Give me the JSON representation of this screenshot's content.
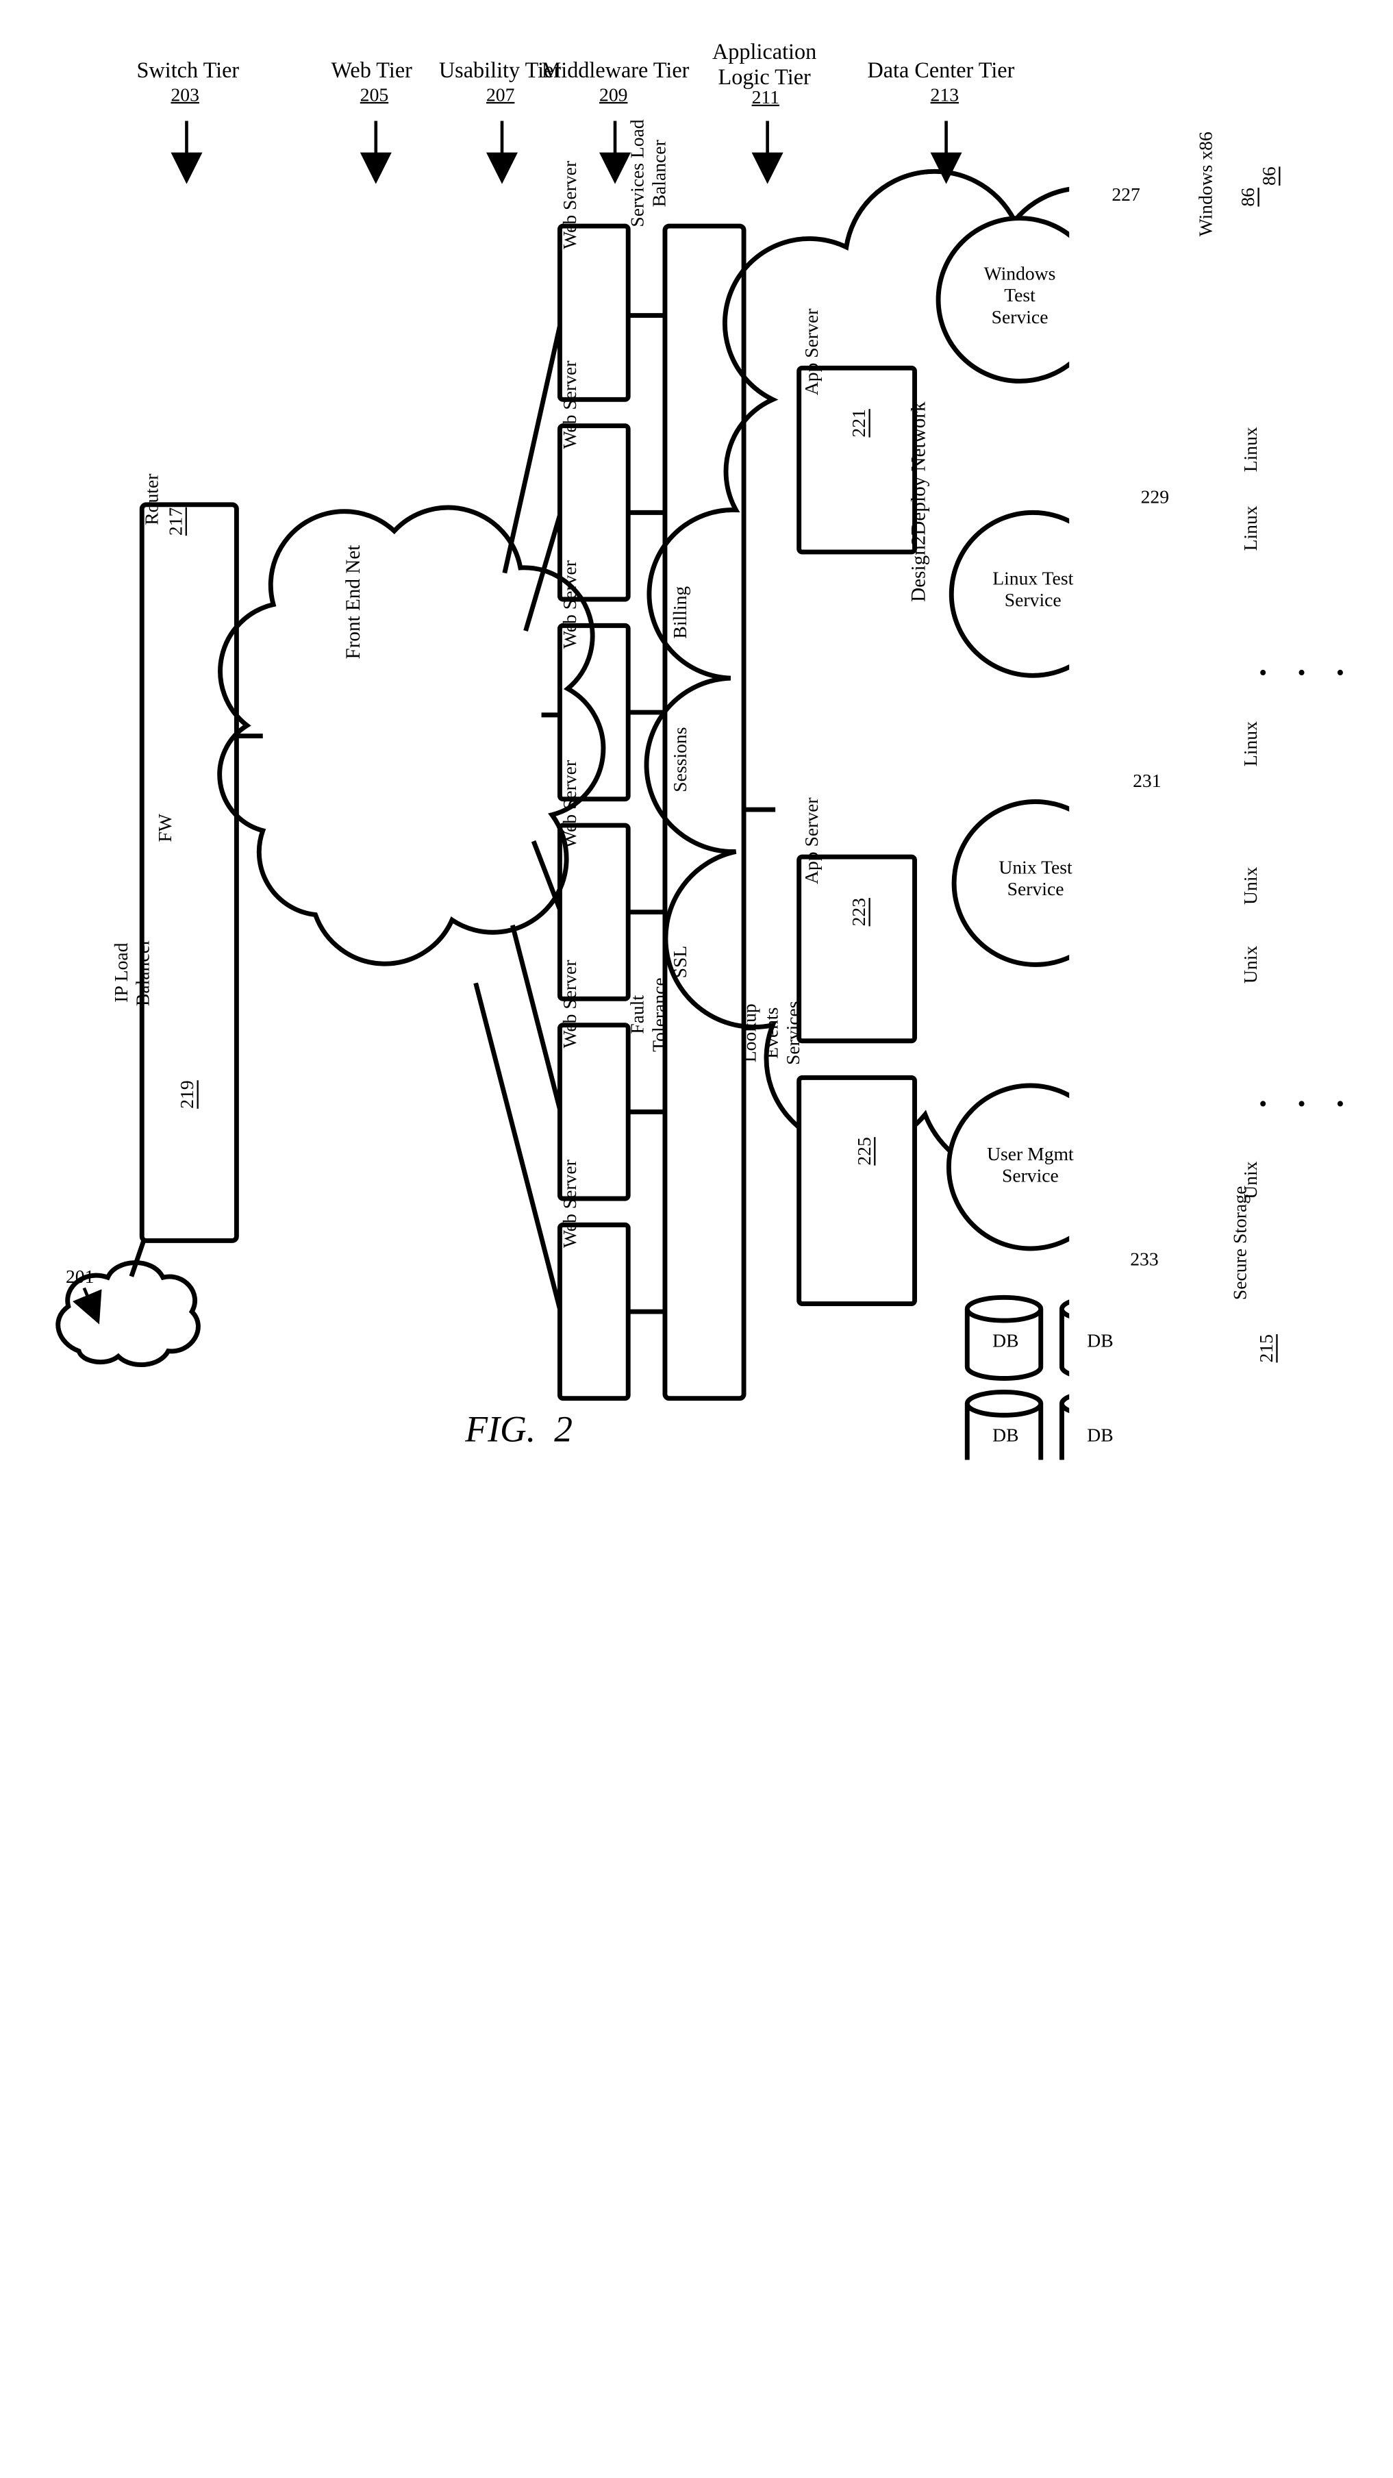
{
  "figure_label": "FIG.  2",
  "tiers": {
    "switch": {
      "title": "Switch Tier",
      "ref": "203"
    },
    "web": {
      "title": "Web Tier",
      "ref": "205"
    },
    "usability": {
      "title": "Usability Tier",
      "ref": "207"
    },
    "middle": {
      "title": "Middleware Tier",
      "ref": "209"
    },
    "app": {
      "title": "Application\nLogic Tier",
      "ref": "211"
    },
    "data": {
      "title": "Data Center Tier",
      "ref": "213"
    }
  },
  "clouds": {
    "internet_ref": "201",
    "front_end": "Front End Net",
    "d2d": "Design2Deploy Network"
  },
  "switch_box": {
    "router": "Router",
    "router_ref": "217",
    "fw": "FW",
    "ip_lb": "IP Load\nBalancer",
    "ip_lb_ref": "219"
  },
  "web_server": "Web Server",
  "usability_box": {
    "slb": "Services Load\nBalancer",
    "billing": "Billing",
    "sessions": "Sessions",
    "ssl": "SSL",
    "fault": "Fault\nTolerance"
  },
  "middleware": {
    "app1": "App Server",
    "app1_ref": "221",
    "app2": "App Server",
    "app2_ref": "223",
    "lookup": "Lookup\nEvents\nServices",
    "lookup_ref": "225"
  },
  "services": {
    "win": {
      "label": "Windows\nTest\nService",
      "ref": "227"
    },
    "lin": {
      "label": "Linux Test\nService",
      "ref": "229"
    },
    "unix": {
      "label": "Unix Test\nService",
      "ref": "231"
    },
    "umgmt": {
      "label": "User Mgmt\nService",
      "ref": "233"
    }
  },
  "db": "DB",
  "datacenter": {
    "winx86": "Windows x86",
    "winx86_ref": "86",
    "linux": "Linux",
    "unix": "Unix",
    "storage": "Secure Storage",
    "storage_ref": "215"
  },
  "ellipsis": "•  •  •"
}
